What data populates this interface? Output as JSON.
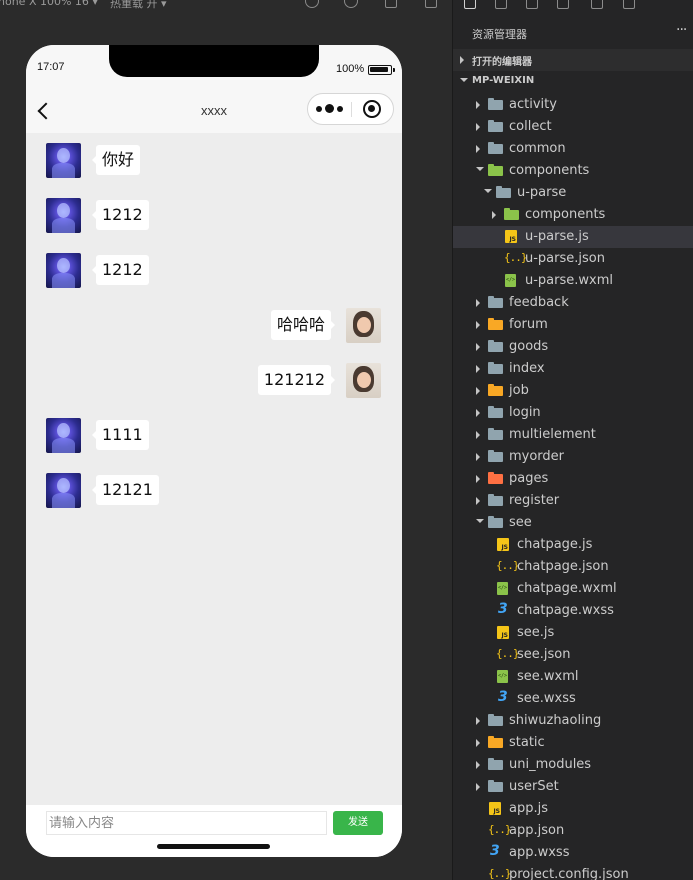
{
  "simulator": {
    "toolbar_left_text": "hone X 100% 16 ▾",
    "toolbar_mode_text": "热重载 开 ▾",
    "status": {
      "time": "17:07",
      "battery": "100%"
    },
    "nav": {
      "title": "xxxx"
    },
    "messages": [
      {
        "side": "left",
        "text": "你好"
      },
      {
        "side": "left",
        "text": "1212"
      },
      {
        "side": "left",
        "text": "1212"
      },
      {
        "side": "right",
        "text": "哈哈哈"
      },
      {
        "side": "right",
        "text": "121212"
      },
      {
        "side": "left",
        "text": "1111"
      },
      {
        "side": "left",
        "text": "12121"
      }
    ],
    "input": {
      "placeholder": "请输入内容",
      "value": ""
    },
    "send_label": "发送"
  },
  "explorer": {
    "title": "资源管理器",
    "more": "···",
    "section_open_editors": "打开的编辑器",
    "section_project": "MP-WEIXIN",
    "tree": [
      {
        "label": "activity",
        "type": "folder",
        "depth": 1,
        "expanded": false,
        "color": "grey"
      },
      {
        "label": "collect",
        "type": "folder",
        "depth": 1,
        "expanded": false,
        "color": "grey"
      },
      {
        "label": "common",
        "type": "folder",
        "depth": 1,
        "expanded": false,
        "color": "grey"
      },
      {
        "label": "components",
        "type": "folder",
        "depth": 1,
        "expanded": true,
        "color": "green"
      },
      {
        "label": "u-parse",
        "type": "folder",
        "depth": 2,
        "expanded": true,
        "color": "grey"
      },
      {
        "label": "components",
        "type": "folder",
        "depth": 3,
        "expanded": false,
        "color": "green"
      },
      {
        "label": "u-parse.js",
        "type": "js",
        "depth": 3,
        "selected": true
      },
      {
        "label": "u-parse.json",
        "type": "json",
        "depth": 3
      },
      {
        "label": "u-parse.wxml",
        "type": "wxml",
        "depth": 3
      },
      {
        "label": "feedback",
        "type": "folder",
        "depth": 1,
        "expanded": false,
        "color": "grey"
      },
      {
        "label": "forum",
        "type": "folder",
        "depth": 1,
        "expanded": false,
        "color": "yellow"
      },
      {
        "label": "goods",
        "type": "folder",
        "depth": 1,
        "expanded": false,
        "color": "grey"
      },
      {
        "label": "index",
        "type": "folder",
        "depth": 1,
        "expanded": false,
        "color": "grey"
      },
      {
        "label": "job",
        "type": "folder",
        "depth": 1,
        "expanded": false,
        "color": "yellow"
      },
      {
        "label": "login",
        "type": "folder",
        "depth": 1,
        "expanded": false,
        "color": "grey"
      },
      {
        "label": "multielement",
        "type": "folder",
        "depth": 1,
        "expanded": false,
        "color": "grey"
      },
      {
        "label": "myorder",
        "type": "folder",
        "depth": 1,
        "expanded": false,
        "color": "grey"
      },
      {
        "label": "pages",
        "type": "folder",
        "depth": 1,
        "expanded": false,
        "color": "orange"
      },
      {
        "label": "register",
        "type": "folder",
        "depth": 1,
        "expanded": false,
        "color": "grey"
      },
      {
        "label": "see",
        "type": "folder",
        "depth": 1,
        "expanded": true,
        "color": "grey"
      },
      {
        "label": "chatpage.js",
        "type": "js",
        "depth": 2
      },
      {
        "label": "chatpage.json",
        "type": "json",
        "depth": 2
      },
      {
        "label": "chatpage.wxml",
        "type": "wxml",
        "depth": 2
      },
      {
        "label": "chatpage.wxss",
        "type": "wxss",
        "depth": 2
      },
      {
        "label": "see.js",
        "type": "js",
        "depth": 2
      },
      {
        "label": "see.json",
        "type": "json",
        "depth": 2
      },
      {
        "label": "see.wxml",
        "type": "wxml",
        "depth": 2
      },
      {
        "label": "see.wxss",
        "type": "wxss",
        "depth": 2
      },
      {
        "label": "shiwuzhaoling",
        "type": "folder",
        "depth": 1,
        "expanded": false,
        "color": "grey"
      },
      {
        "label": "static",
        "type": "folder",
        "depth": 1,
        "expanded": false,
        "color": "yellow"
      },
      {
        "label": "uni_modules",
        "type": "folder",
        "depth": 1,
        "expanded": false,
        "color": "grey"
      },
      {
        "label": "userSet",
        "type": "folder",
        "depth": 1,
        "expanded": false,
        "color": "grey"
      },
      {
        "label": "app.js",
        "type": "js",
        "depth": 1
      },
      {
        "label": "app.json",
        "type": "json",
        "depth": 1
      },
      {
        "label": "app.wxss",
        "type": "wxss",
        "depth": 1
      },
      {
        "label": "project.config.json",
        "type": "json",
        "depth": 1
      }
    ]
  }
}
